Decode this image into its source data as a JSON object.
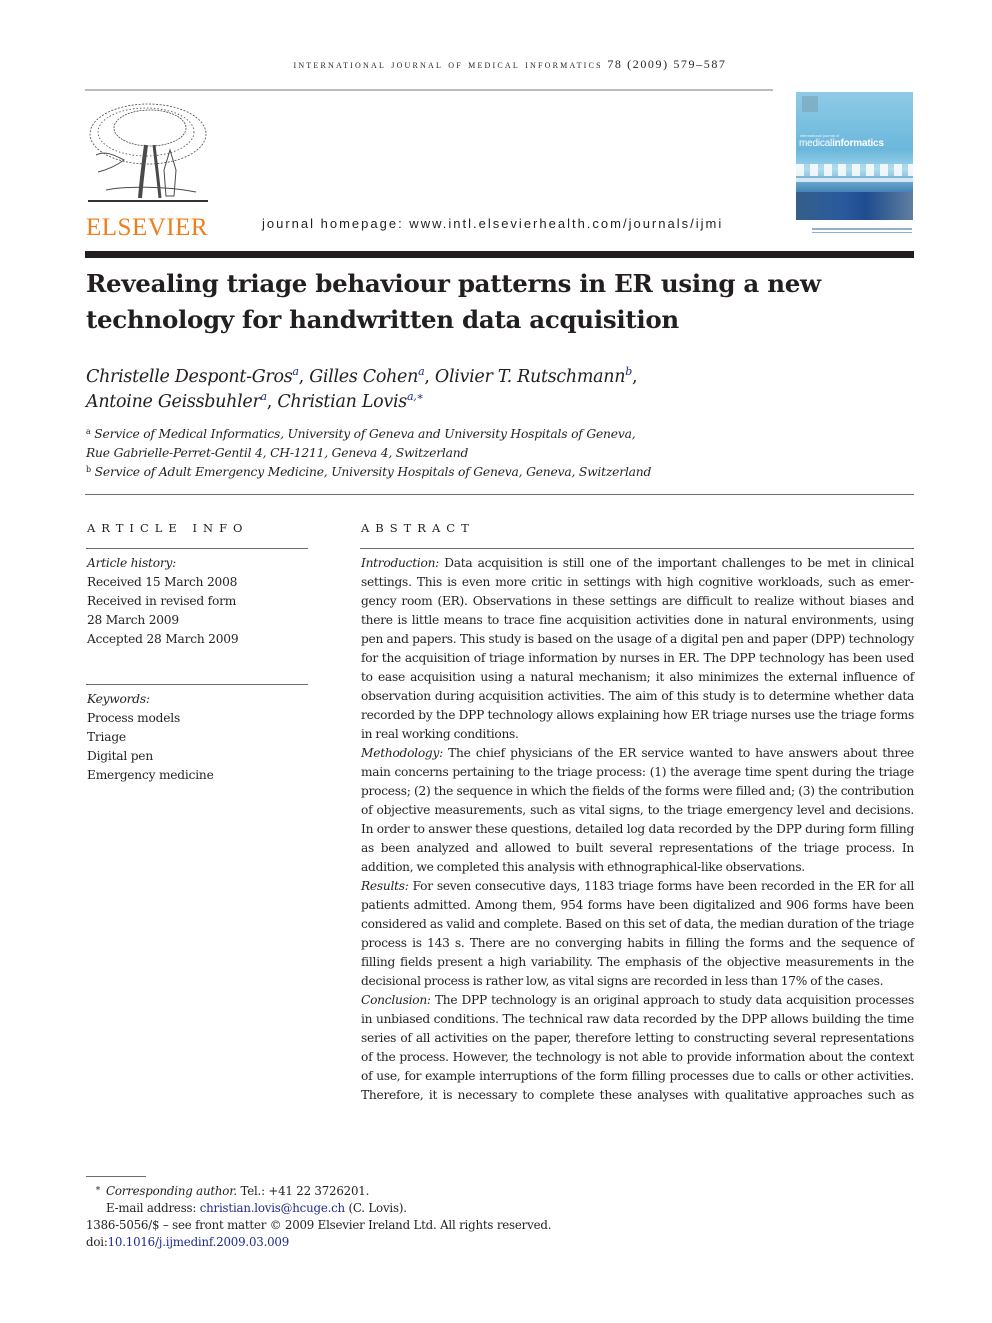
{
  "header": {
    "journal_running_head": "international journal of medical informatics",
    "volume_info": "78 (2009) 579–587",
    "publisher_logo_text": "ELSEVIER",
    "homepage_label": "journal homepage: www.intl.elsevierhealth.com/journals/ijmi",
    "cover": {
      "small_text": "international journal of",
      "title_light": "medical",
      "title_bold": "informatics"
    },
    "brand_color": "#f07d1b"
  },
  "article": {
    "title_line1": "Revealing triage behaviour patterns in ER using a new",
    "title_line2": "technology for handwritten data acquisition",
    "authors": [
      {
        "name": "Christelle Despont-Gros",
        "sup": "a",
        "sep": ", "
      },
      {
        "name": "Gilles Cohen",
        "sup": "a",
        "sep": ", "
      },
      {
        "name": "Olivier T. Rutschmann",
        "sup": "b",
        "sep": ","
      },
      {
        "name": "Antoine Geissbuhler",
        "sup": "a",
        "sep": ", "
      },
      {
        "name": "Christian Lovis",
        "sup": "a,∗",
        "sep": ""
      }
    ],
    "affiliations": [
      {
        "mark": "a",
        "line1": "Service of Medical Informatics, University of Geneva and University Hospitals of Geneva,",
        "line2": "Rue Gabrielle-Perret-Gentil 4, CH-1211, Geneva 4, Switzerland"
      },
      {
        "mark": "b",
        "line1": "Service of Adult Emergency Medicine, University Hospitals of Geneva, Geneva, Switzerland"
      }
    ]
  },
  "article_info": {
    "heading": "article info",
    "history_label": "Article history:",
    "history": [
      "Received 15 March 2008",
      "Received in revised form",
      "28 March 2009",
      "Accepted 28 March 2009"
    ],
    "keywords_label": "Keywords:",
    "keywords": [
      "Process models",
      "Triage",
      "Digital pen",
      "Emergency medicine"
    ]
  },
  "abstract": {
    "heading": "abstract",
    "sections": [
      {
        "label": "Introduction:",
        "text": " Data acquisition is still one of the important challenges to be met in clinical settings. This is even more critic in settings with high cognitive workloads, such as emer­gency room (ER). Observations in these settings are difficult to realize without biases and there is little means to trace fine acquisition activities done in natural environments, using pen and papers. This study is based on the usage of a digital pen and paper (DPP) technology for the acquisition of triage information by nurses in ER. The DPP technology has been used to ease acquisition using a natural mechanism; it also minimizes the external influence of observation during acquisition activities. The aim of this study is to determine whether data recorded by the DPP technology allows explaining how ER triage nurses use the triage forms in real working conditions."
      },
      {
        "label": "Methodology:",
        "text": " The chief physicians of the ER service wanted to have answers about three main concerns pertaining to the triage process: (1) the average time spent during the triage process; (2) the sequence in which the fields of the forms were filled and; (3) the contribution of objective measurements, such as vital signs, to the triage emergency level and decisions. In order to answer these questions, detailed log data recorded by the DPP during form fill­ing as been analyzed and allowed to built several representations of the triage process. In addition, we completed this analysis with ethnographical-like observations."
      },
      {
        "label": "Results:",
        "text": " For seven consecutive days, 1183 triage forms have been recorded in the ER for all patients admitted. Among them, 954 forms have been digitalized and 906 forms have been considered as valid and complete. Based on this set of data, the median duration of the triage process is 143 s. There are no converging habits in filling the forms and the sequence of filling fields present a high variability. The emphasis of the objective measurements in the decisional process is rather low, as vital signs are recorded in less than 17% of the cases."
      },
      {
        "label": "Conclusion:",
        "text": " The DPP technology is an original approach to study data acquisition processes in unbiased conditions. The technical raw data recorded by the DPP allows building the time series of all activities on the paper, therefore letting to constructing several representations of the process. However, the technology is not able to provide information about the context of use, for example interruptions of the form filling processes due to calls or other activities. Therefore, it is necessary to complete these analyses with qualitative approaches such as"
      }
    ]
  },
  "footnotes": {
    "star": "*",
    "corresponding_label": "Corresponding author.",
    "tel": " Tel.: +41 22 3726201.",
    "email_label": "E-mail address: ",
    "email": "christian.lovis@hcuge.ch",
    "email_suffix": " (C. Lovis).",
    "copyright": "1386-5056/$ – see front matter © 2009 Elsevier Ireland Ltd. All rights reserved.",
    "doi_label": "doi:",
    "doi": "10.1016/j.ijmedinf.2009.03.009",
    "link_color": "#1d2a8c"
  }
}
